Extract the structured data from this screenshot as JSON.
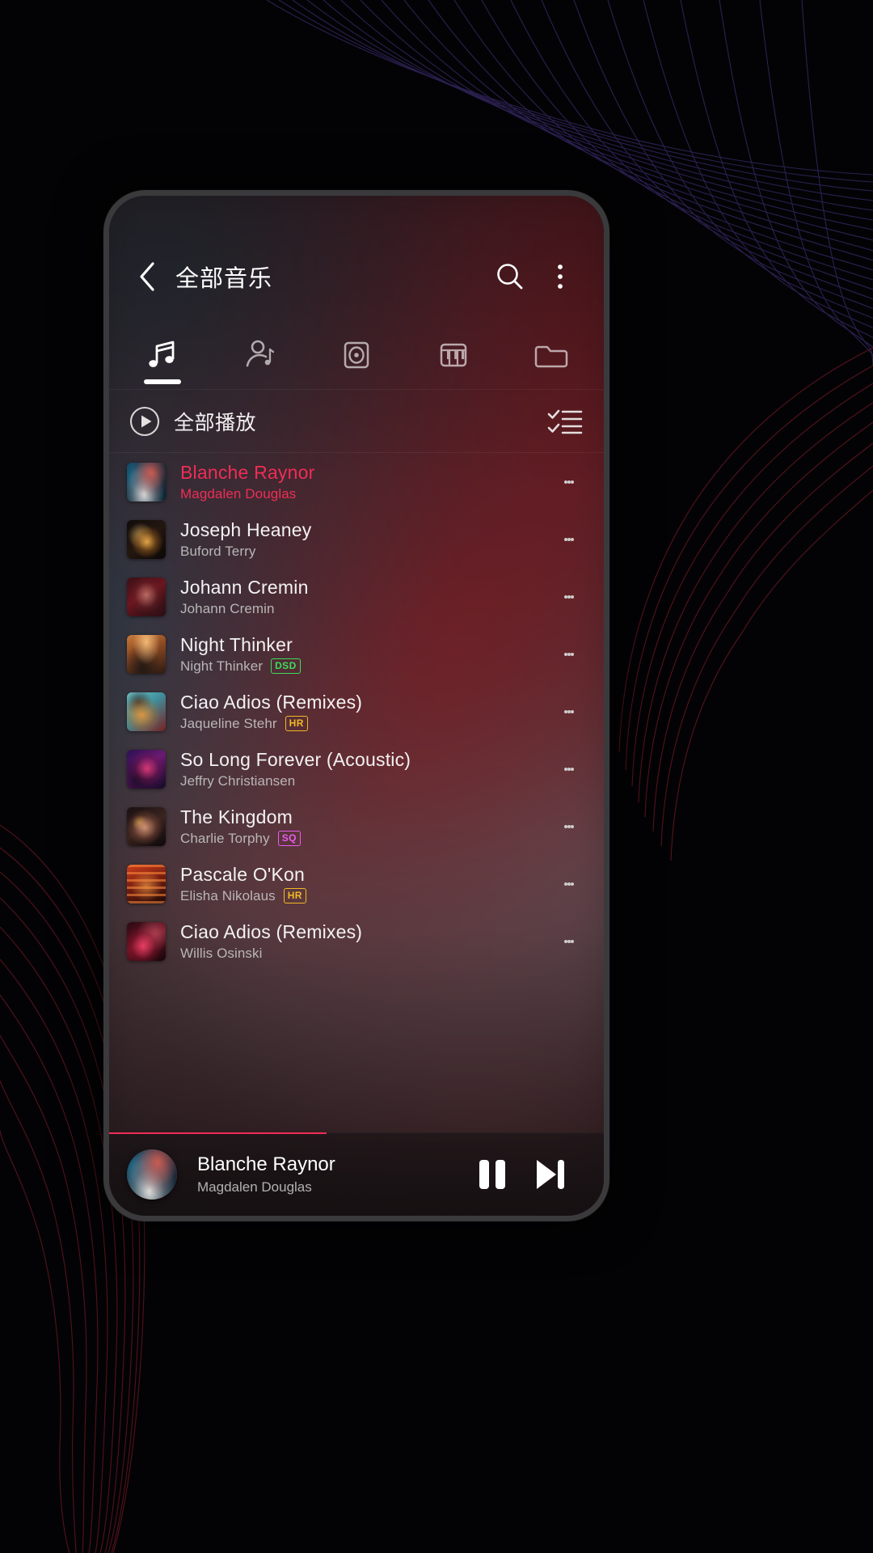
{
  "app": {
    "header": {
      "title": "全部音乐",
      "back_icon": "chevron-left-icon",
      "search_icon": "search-icon",
      "overflow_icon": "more-vertical-icon"
    },
    "tabs": [
      {
        "name": "songs",
        "icon": "music-note-icon",
        "active": true
      },
      {
        "name": "artists",
        "icon": "artist-icon",
        "active": false
      },
      {
        "name": "albums",
        "icon": "album-disc-icon",
        "active": false
      },
      {
        "name": "genres",
        "icon": "piano-icon",
        "active": false
      },
      {
        "name": "folders",
        "icon": "folder-icon",
        "active": false
      }
    ],
    "playall": {
      "label": "全部播放",
      "play_icon": "play-circle-icon",
      "multiselect_icon": "checklist-icon"
    },
    "songs": [
      {
        "title": "Blanche Raynor",
        "artist": "Magdalen Douglas",
        "badge": "",
        "badge_color": "",
        "playing": true,
        "art": "art-1"
      },
      {
        "title": "Joseph Heaney",
        "artist": "Buford Terry",
        "badge": "",
        "badge_color": "",
        "playing": false,
        "art": "art-2"
      },
      {
        "title": "Johann Cremin",
        "artist": "Johann Cremin",
        "badge": "",
        "badge_color": "",
        "playing": false,
        "art": "art-3"
      },
      {
        "title": "Night Thinker",
        "artist": "Night Thinker",
        "badge": "DSD",
        "badge_color": "#3ddc5a",
        "playing": false,
        "art": "art-4"
      },
      {
        "title": "Ciao Adios (Remixes)",
        "artist": "Jaqueline Stehr",
        "badge": "HR",
        "badge_color": "#f2b824",
        "playing": false,
        "art": "art-5"
      },
      {
        "title": "So Long Forever (Acoustic)",
        "artist": "Jeffry Christiansen",
        "badge": "",
        "badge_color": "",
        "playing": false,
        "art": "art-6"
      },
      {
        "title": "The Kingdom",
        "artist": "Charlie Torphy",
        "badge": "SQ",
        "badge_color": "#e85cf0",
        "playing": false,
        "art": "art-7"
      },
      {
        "title": "Pascale O'Kon",
        "artist": "Elisha Nikolaus",
        "badge": "HR",
        "badge_color": "#f2b824",
        "playing": false,
        "art": "art-8"
      },
      {
        "title": "Ciao Adios (Remixes)",
        "artist": "Willis Osinski",
        "badge": "",
        "badge_color": "",
        "playing": false,
        "art": "art-9"
      }
    ],
    "miniplayer": {
      "title": "Blanche Raynor",
      "artist": "Magdalen Douglas",
      "pause_icon": "pause-icon",
      "next_icon": "skip-next-icon",
      "art": "art-1"
    },
    "colors": {
      "accent": "#ef2d56",
      "text_primary": "#f3f2f2",
      "text_secondary": "#b9b6b6",
      "screen_bg": "#241b1e"
    }
  }
}
